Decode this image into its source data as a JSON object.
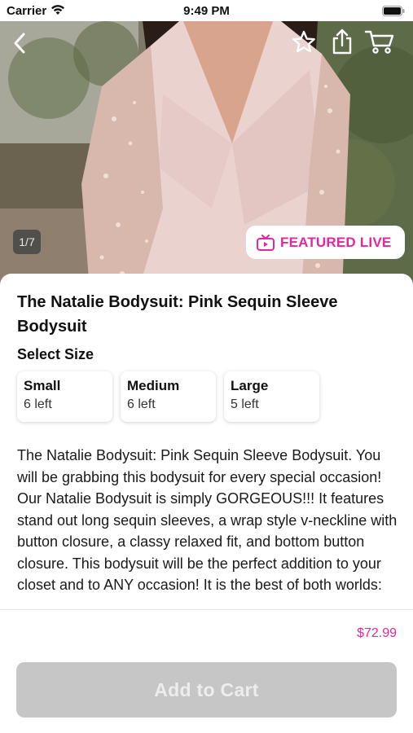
{
  "status_bar": {
    "carrier": "Carrier",
    "time": "9:49 PM"
  },
  "hero": {
    "image_counter": "1/7",
    "featured_live_label": "FEATURED LIVE",
    "icons": [
      "chevron-left-icon",
      "star-icon",
      "share-icon",
      "cart-icon",
      "tv-icon"
    ]
  },
  "product": {
    "title": "The Natalie Bodysuit: Pink Sequin Sleeve Bodysuit",
    "select_size_label": "Select Size",
    "sizes": [
      {
        "name": "Small",
        "stock": "6 left"
      },
      {
        "name": "Medium",
        "stock": "6 left"
      },
      {
        "name": "Large",
        "stock": "5 left"
      }
    ],
    "description": "The Natalie Bodysuit: Pink Sequin Sleeve Bodysuit. You will be grabbing this bodysuit for every special occasion! Our Natalie Bodysuit is simply GORGEOUS!!!  It features stand out long sequin sleeves, a wrap style v-neckline with button closure, a classy relaxed fit, and bottom button closure. This bodysuit will be the perfect addition to your closet and to ANY occasion!  It is the best of both worlds:"
  },
  "footer": {
    "price": "$72.99",
    "add_to_cart_label": "Add to Cart"
  },
  "colors": {
    "accent_pink": "#e8259c",
    "disabled_button": "#c6c6c6"
  }
}
